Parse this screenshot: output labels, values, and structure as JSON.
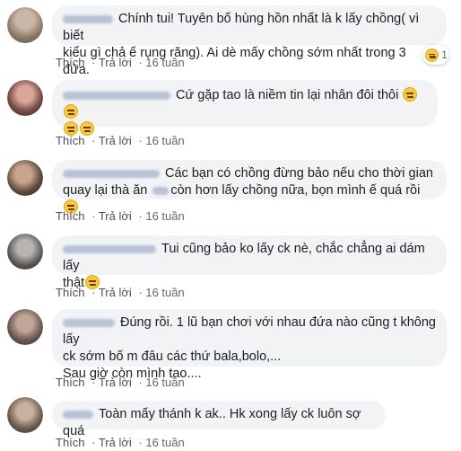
{
  "comments": [
    {
      "author_blurred": "",
      "text_line1": "Chính tui! Tuyên bố hùng hồn nhất là k lấy chồng( vì biết",
      "text_line2": "kiểu gì chả ế rụng răng). Ai dè mấy chồng sớm nhất trong 3 đứa.",
      "reaction_count": "1",
      "like": "Thích",
      "reply": "Trả lời",
      "time": "16 tuần"
    },
    {
      "text_line1": "Cứ gặp tao là niềm tin lại nhân đôi thôi",
      "like": "Thích",
      "reply": "Trả lời",
      "time": "16 tuần"
    },
    {
      "text_line1": "Các bạn có chồng đừng bảo nếu cho thời gian",
      "text_line2": "quay lại thà ăn",
      "text_line2b": "còn hơn lấy chồng nữa, bọn mình ế quá rồi",
      "like": "Thích",
      "reply": "Trả lời",
      "time": "16 tuần"
    },
    {
      "text_line1": "Tui cũng bảo ko lấy ck nè, chắc chẳng ai dám lấy",
      "text_line2": "thật",
      "like": "Thích",
      "reply": "Trả lời",
      "time": "16 tuần"
    },
    {
      "text_line1": "Đúng rồi. 1 lũ bạn chơi với nhau đứa nào cũng t không lấy",
      "text_line2": "ck sớm bố m đâu các thứ bala,bolo,...",
      "text_line3": "Sau giờ còn mình tao....",
      "like": "Thích",
      "reply": "Trả lời",
      "time": "16 tuần"
    },
    {
      "text_line1": "Toàn mấy thánh k ak.. Hk xong lấy ck luôn sợ quá",
      "like": "Thích",
      "reply": "Trả lời",
      "time": "16 tuần"
    }
  ],
  "colors": {
    "bubble": "#f2f3f5",
    "meta": "#606770",
    "text": "#1c1e21"
  },
  "icons": [
    "avatar",
    "emoji-icon",
    "grin-reaction-icon"
  ]
}
